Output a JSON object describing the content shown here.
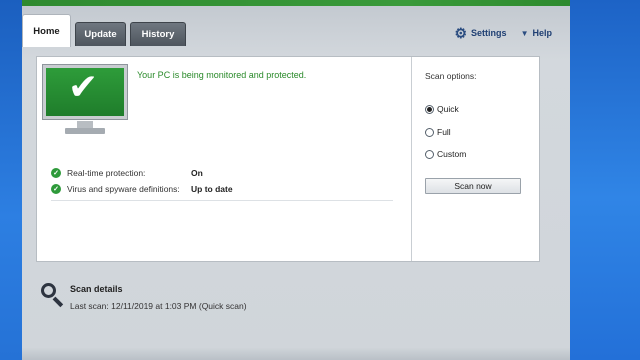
{
  "tabs": [
    {
      "label": "Home"
    },
    {
      "label": "Update"
    },
    {
      "label": "History"
    }
  ],
  "toplinks": {
    "settings": "Settings",
    "help": "Help"
  },
  "status": {
    "message": "Your PC is being monitored and protected."
  },
  "protection": [
    {
      "label": "Real-time protection:",
      "value": "On"
    },
    {
      "label": "Virus and spyware definitions:",
      "value": "Up to date"
    }
  ],
  "scan_options": {
    "title": "Scan options:",
    "options": [
      "Quick",
      "Full",
      "Custom"
    ],
    "selected": "Quick",
    "button": "Scan now"
  },
  "scan_details": {
    "title": "Scan details",
    "last_scan_label": "Last scan:",
    "last_scan_value": "12/11/2019 at 1:03 PM (Quick scan)"
  },
  "colors": {
    "accent_green": "#2e9c3a",
    "status_text": "#2a8a2a",
    "link_blue": "#1f3f73"
  },
  "icons": {
    "status": "monitor-check-icon",
    "settings": "gear-icon",
    "help": "caret-down-icon",
    "scan_details": "magnifier-icon",
    "ok": "check-circle-icon"
  }
}
